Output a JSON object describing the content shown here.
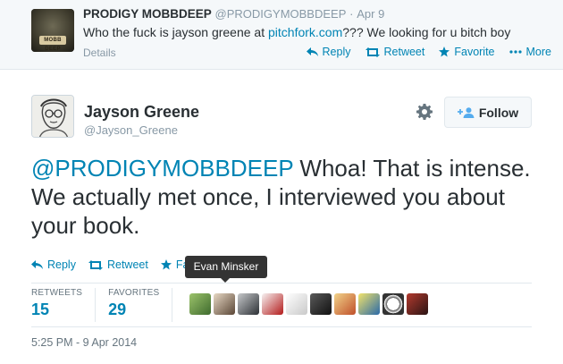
{
  "parent_tweet": {
    "name": "PRODIGY MOBBDEEP",
    "handle": "@PRODIGYMOBBDEEP",
    "separator": "·",
    "time": "Apr 9",
    "text_before": "Who the fuck is jayson greene at ",
    "link": "pitchfork.com",
    "text_after": "??? We looking for u bitch boy",
    "details_label": "Details",
    "avatar_badge": "MOBB DEEP",
    "actions": {
      "reply": "Reply",
      "retweet": "Retweet",
      "favorite": "Favorite",
      "more": "More"
    }
  },
  "tweet": {
    "name": "Jayson Greene",
    "handle": "@Jayson_Greene",
    "follow_label": "Follow",
    "mention": "@PRODIGYMOBBDEEP",
    "text": " Whoa! That is intense. We actually met once, I interviewed you about your book.",
    "actions": {
      "reply": "Reply",
      "retweet": "Retweet",
      "favorite": "Fav"
    },
    "tooltip": "Evan Minsker",
    "stats": {
      "retweets_label": "RETWEETS",
      "retweets": "15",
      "favorites_label": "FAVORITES",
      "favorites": "29"
    },
    "timestamp": "5:25 PM - 9 Apr 2014"
  },
  "colors": {
    "link": "#0084b4",
    "muted": "#8899a6",
    "text": "#292f33",
    "parent_bg": "#f5f8fa"
  },
  "icons": {
    "reply": "reply-icon",
    "retweet": "retweet-icon",
    "favorite": "star-icon",
    "more": "ellipsis-icon",
    "settings": "gear-icon",
    "follow": "add-user-icon"
  }
}
